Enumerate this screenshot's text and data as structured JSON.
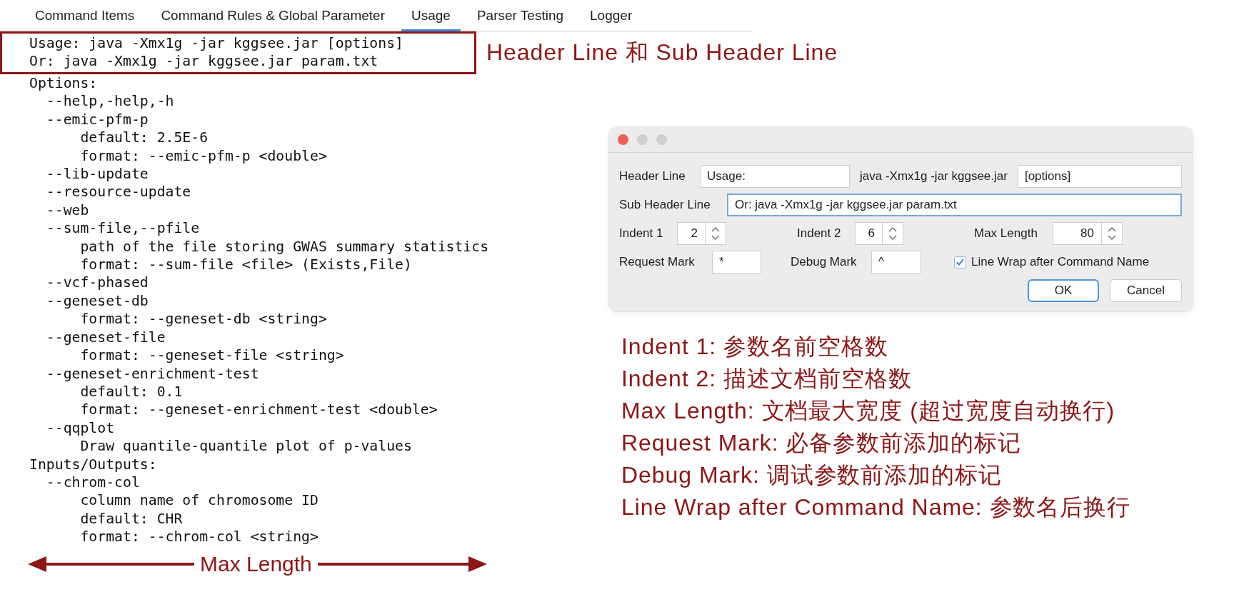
{
  "tabs": [
    {
      "label": "Command Items",
      "selected": false
    },
    {
      "label": "Command Rules & Global Parameter",
      "selected": false
    },
    {
      "label": "Usage",
      "selected": true
    },
    {
      "label": "Parser Testing",
      "selected": false
    },
    {
      "label": "Logger",
      "selected": false
    }
  ],
  "usage": {
    "header_lines": [
      "Usage: java -Xmx1g -jar kggsee.jar [options]",
      "Or: java -Xmx1g -jar kggsee.jar param.txt"
    ],
    "sections": [
      {
        "title": "Options:",
        "children": [
          {
            "text": "--help,-help,-h"
          },
          {
            "text": "--emic-pfm-p",
            "children": [
              {
                "text": "default: 2.5E-6"
              },
              {
                "text": "format: --emic-pfm-p <double>"
              }
            ]
          },
          {
            "text": "--lib-update"
          },
          {
            "text": "--resource-update"
          },
          {
            "text": "--web"
          },
          {
            "text": "--sum-file,--pfile",
            "children": [
              {
                "text": "path of the file storing GWAS summary statistics"
              },
              {
                "text": "format: --sum-file <file> (Exists,File)"
              }
            ]
          },
          {
            "text": "--vcf-phased"
          },
          {
            "text": "--geneset-db",
            "children": [
              {
                "text": "format: --geneset-db <string>"
              }
            ]
          },
          {
            "text": "--geneset-file",
            "children": [
              {
                "text": "format: --geneset-file <string>"
              }
            ]
          },
          {
            "text": "--geneset-enrichment-test",
            "children": [
              {
                "text": "default: 0.1"
              },
              {
                "text": "format: --geneset-enrichment-test <double>"
              }
            ]
          },
          {
            "text": "--qqplot",
            "children": [
              {
                "text": "Draw quantile-quantile plot of p-values"
              }
            ]
          }
        ]
      },
      {
        "title": "Inputs/Outputs:",
        "children": [
          {
            "text": "--chrom-col",
            "children": [
              {
                "text": "column name of chromosome ID"
              },
              {
                "text": "default: CHR"
              },
              {
                "text": "format: --chrom-col <string>"
              }
            ]
          }
        ]
      }
    ]
  },
  "header_note": "Header Line 和 Sub Header Line",
  "width_marker": {
    "label": "Max Length"
  },
  "dialog": {
    "window_buttons": [
      {
        "kind": "close",
        "disabled": false
      },
      {
        "kind": "minimize",
        "disabled": true
      },
      {
        "kind": "zoom",
        "disabled": true
      }
    ],
    "header_line": {
      "label": "Header Line",
      "prefix": "Usage:",
      "command": "java -Xmx1g -jar kggsee.jar",
      "suffix": "[options]"
    },
    "sub_header_line": {
      "label": "Sub Header Line",
      "value": "Or: java -Xmx1g -jar kggsee.jar param.txt",
      "focused": true
    },
    "indent_1": {
      "label": "Indent 1",
      "value": "2"
    },
    "indent_2": {
      "label": "Indent 2",
      "value": "6"
    },
    "max_length": {
      "label": "Max Length",
      "value": "80"
    },
    "request_mark": {
      "label": "Request Mark",
      "value": "*"
    },
    "debug_mark": {
      "label": "Debug Mark",
      "value": "^"
    },
    "line_wrap": {
      "label": "Line Wrap after Command Name",
      "checked": true
    },
    "buttons": [
      {
        "label": "OK",
        "default": true
      },
      {
        "label": "Cancel",
        "default": false
      }
    ]
  },
  "notes": [
    "Indent 1: 参数名前空格数",
    "Indent 2: 描述文档前空格数",
    "Max Length: 文档最大宽度 (超过宽度自动换行)",
    "Request Mark: 必备参数前添加的标记",
    "Debug Mark: 调试参数前添加的标记",
    "Line Wrap after Command Name: 参数名后换行"
  ]
}
